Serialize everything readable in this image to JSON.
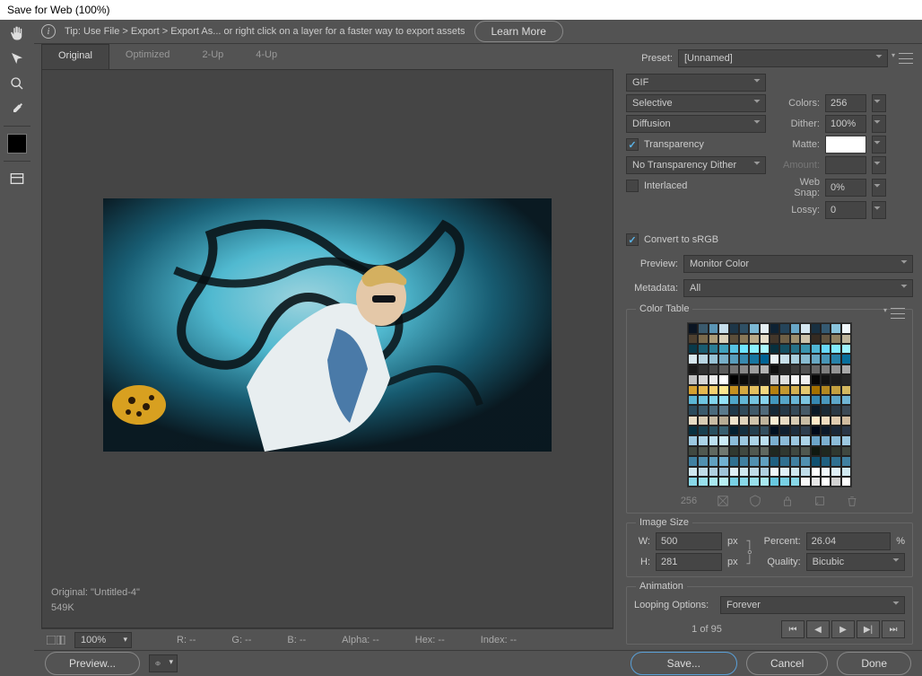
{
  "window_title": "Save for Web (100%)",
  "tip": "Tip: Use File > Export > Export As...  or right click on a layer for a faster way to export assets",
  "learn_more": "Learn More",
  "tabs": [
    "Original",
    "Optimized",
    "2-Up",
    "4-Up"
  ],
  "active_tab": 0,
  "image_info_line1": "Original: \"Untitled-4\"",
  "image_info_line2": "549K",
  "zoom": "100%",
  "status": {
    "r": "R: --",
    "g": "G: --",
    "b": "B: --",
    "alpha": "Alpha: --",
    "hex": "Hex: --",
    "index": "Index: --"
  },
  "preset_label": "Preset:",
  "preset_value": "[Unnamed]",
  "format": "GIF",
  "reduction": "Selective",
  "colors_label": "Colors:",
  "colors_value": "256",
  "dither_method": "Diffusion",
  "dither_label": "Dither:",
  "dither_value": "100%",
  "transparency_label": "Transparency",
  "transparency_checked": true,
  "matte_label": "Matte:",
  "trans_dither": "No Transparency Dither",
  "amount_label": "Amount:",
  "interlaced_label": "Interlaced",
  "interlaced_checked": false,
  "websnap_label": "Web Snap:",
  "websnap_value": "0%",
  "lossy_label": "Lossy:",
  "lossy_value": "0",
  "convert_srgb_label": "Convert to sRGB",
  "convert_srgb_checked": true,
  "preview_label": "Preview:",
  "preview_value": "Monitor Color",
  "metadata_label": "Metadata:",
  "metadata_value": "All",
  "color_table_title": "Color Table",
  "color_count": "256",
  "image_size_title": "Image Size",
  "w_label": "W:",
  "w_value": "500",
  "h_label": "H:",
  "h_value": "281",
  "px": "px",
  "percent_label": "Percent:",
  "percent_value": "26.04",
  "percent_unit": "%",
  "quality_label": "Quality:",
  "quality_value": "Bicubic",
  "animation_title": "Animation",
  "looping_label": "Looping Options:",
  "looping_value": "Forever",
  "frame_counter": "1 of 95",
  "preview_btn": "Preview...",
  "save_btn": "Save...",
  "cancel_btn": "Cancel",
  "done_btn": "Done",
  "color_table_colors": [
    "#0b1523",
    "#3a5a6d",
    "#5a94b4",
    "#c5ddeb",
    "#1d3648",
    "#2f5065",
    "#7cb8d4",
    "#e4eef3",
    "#0e2233",
    "#25445a",
    "#69a7c7",
    "#d5e7f1",
    "#183041",
    "#355a72",
    "#8ac4dc",
    "#eff6fa",
    "#4e4030",
    "#7a6a4c",
    "#ab9c78",
    "#d9cfb8",
    "#5b4e3a",
    "#887858",
    "#b9aa88",
    "#e6ddc8",
    "#42362a",
    "#6f6046",
    "#9d8f6e",
    "#ccc2aa",
    "#352b22",
    "#625540",
    "#908263",
    "#bfb59c",
    "#0a3a4a",
    "#1a5c70",
    "#2c7e96",
    "#40a0bc",
    "#56c2e2",
    "#6ee4ff",
    "#8af0ff",
    "#a8f8ff",
    "#07303e",
    "#155062",
    "#277288",
    "#3a94ae",
    "#50b6d4",
    "#68d8fa",
    "#82eaff",
    "#9ef2ff",
    "#d8e8ef",
    "#b8d5e2",
    "#98c2d5",
    "#78afc8",
    "#589cbb",
    "#3889ae",
    "#1876a1",
    "#006394",
    "#e8f2f6",
    "#c8e0ea",
    "#a8cedd",
    "#88bbd0",
    "#68a8c3",
    "#4895b6",
    "#2882a9",
    "#086f9c",
    "#1a1a1a",
    "#303030",
    "#464646",
    "#5c5c5c",
    "#727272",
    "#888888",
    "#9e9e9e",
    "#b4b4b4",
    "#101010",
    "#262626",
    "#3c3c3c",
    "#525252",
    "#686868",
    "#7e7e7e",
    "#949494",
    "#aaaaaa",
    "#c0c0c0",
    "#d6d6d6",
    "#ececec",
    "#ffffff",
    "#000000",
    "#0a0a0a",
    "#141414",
    "#1e1e1e",
    "#cacaca",
    "#e0e0e0",
    "#f6f6f6",
    "#f0f0f0",
    "#060606",
    "#121212",
    "#1c1c1c",
    "#282828",
    "#d4a030",
    "#e4b850",
    "#f4d070",
    "#ffe890",
    "#c49020",
    "#d4a840",
    "#e4c060",
    "#f4d880",
    "#b48010",
    "#c49830",
    "#d4b050",
    "#e4c870",
    "#a47000",
    "#b48820",
    "#c4a040",
    "#d4b860",
    "#5bb5d4",
    "#6ec4e0",
    "#81d3ec",
    "#94e2f8",
    "#4fa6c8",
    "#62b5d4",
    "#75c4e0",
    "#88d3ec",
    "#4397bc",
    "#56a6c8",
    "#69b5d4",
    "#7cc4e0",
    "#3788b0",
    "#4a97bc",
    "#5da6c8",
    "#70b5d4",
    "#2a4a5c",
    "#3a5a6c",
    "#4a6a7c",
    "#5a7a8c",
    "#203a4a",
    "#304a5a",
    "#405a6a",
    "#506a7a",
    "#162a38",
    "#263a48",
    "#364a58",
    "#465a68",
    "#0c1a26",
    "#1c2a36",
    "#2c3a46",
    "#3c4a56",
    "#e8dcc4",
    "#d8ccb4",
    "#c8bca4",
    "#b8ac94",
    "#f0e4cc",
    "#e0d4bc",
    "#d0c4ac",
    "#c0b49c",
    "#f8ecd4",
    "#e8dcc4",
    "#d8ccb4",
    "#c8bca4",
    "#ffe8c8",
    "#f0dcc0",
    "#e0ccb0",
    "#d0bca0",
    "#083040",
    "#184050",
    "#285060",
    "#386070",
    "#042030",
    "#143040",
    "#244050",
    "#345060",
    "#001020",
    "#102030",
    "#203040",
    "#304050",
    "#000818",
    "#0c1828",
    "#1c2838",
    "#2c3848",
    "#9cc8e0",
    "#acd4e8",
    "#bce0f0",
    "#ccecf8",
    "#8cbcd8",
    "#9cc8e0",
    "#acd4e8",
    "#bce0f0",
    "#7cb0d0",
    "#8cbcd8",
    "#9cc8e0",
    "#acd4e8",
    "#6ca4c8",
    "#7cb0d0",
    "#8cbcd8",
    "#9cc8e0",
    "#404840",
    "#505850",
    "#606860",
    "#707870",
    "#303830",
    "#404840",
    "#505850",
    "#606860",
    "#202820",
    "#303830",
    "#404840",
    "#505850",
    "#101810",
    "#202820",
    "#303830",
    "#404840",
    "#4080a0",
    "#5090b0",
    "#60a0c0",
    "#70b0d0",
    "#307090",
    "#4080a0",
    "#5090b0",
    "#60a0c0",
    "#206080",
    "#307090",
    "#4080a0",
    "#5090b0",
    "#105070",
    "#206080",
    "#307090",
    "#4080a0",
    "#d0e8f0",
    "#c0dce8",
    "#b0d0e0",
    "#a0c4d8",
    "#e0f0f8",
    "#d0e8f0",
    "#c0dce8",
    "#b0d0e0",
    "#f0f8fc",
    "#e0f0f8",
    "#d0e8f0",
    "#c0dce8",
    "#ffffff",
    "#f0f8fc",
    "#e0f0f8",
    "#d0e8f0",
    "#88d8e8",
    "#98e0ec",
    "#a8e8f0",
    "#b8f0f4",
    "#78d0e4",
    "#88d8e8",
    "#98e0ec",
    "#a8e8f0",
    "#68c8e0",
    "#78d0e4",
    "#88d8e8",
    "#f8f8f8",
    "#e8e8e8",
    "#ffffff",
    "#d2d2d2",
    "#ffffff"
  ]
}
